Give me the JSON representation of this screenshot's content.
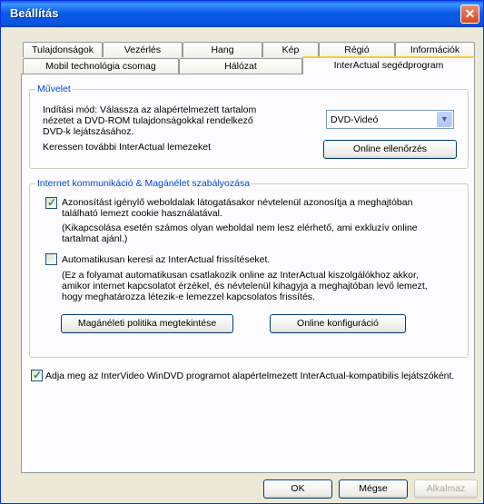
{
  "window": {
    "title": "Beállítás",
    "close_label": "✕"
  },
  "tabs_row1": [
    "Tulajdonságok",
    "Vezérlés",
    "Hang",
    "Kép",
    "Régió",
    "Információk"
  ],
  "tabs_row2": [
    "Mobil technológia csomag",
    "Hálózat",
    "InterActual segédprogram"
  ],
  "active_tab": "InterActual segédprogram",
  "muvelet": {
    "legend": "Művelet",
    "startup_line1": "Indítási mód: Válassza az alapértelmezett tartalom",
    "startup_line2": "nézetet a DVD-ROM tulajdonságokkal rendelkező",
    "startup_line3": "DVD-k lejátszásához.",
    "startup_select_value": "DVD-Videó",
    "search_label": "Keressen további InterActual lemezeket",
    "online_check_button": "Online ellenőrzés"
  },
  "privacy": {
    "legend": "Internet kommunikáció & Magánélet szabályozása",
    "cookie_line1": "Azonosítást igénylő weboldalak látogatásakor névtelenül azonosítja a meghajtóban",
    "cookie_line2": "található lemezt cookie használatával.",
    "cookie_note1": "(Kikapcsolása esetén számos olyan weboldal nem lesz elérhető, ami exkluzív online",
    "cookie_note2": "tartalmat ajánl.)",
    "cookie_checked": true,
    "auto_label": "Automatikusan keresi az InterActual frissítéseket.",
    "auto_checked": false,
    "auto_note1": "(Ez a folyamat automatikusan csatlakozik online az InterActual kiszolgálókhoz akkor,",
    "auto_note2": "amikor internet kapcsolatot érzékel, és névtelenül kihagyja a meghajtóban levő lemezt,",
    "auto_note3": "hogy meghatározza létezik-e lemezzel kapcsolatos frissítés.",
    "privacy_policy_button": "Magánéleti politika megtekintése",
    "online_config_button": "Online konfiguráció"
  },
  "default_player": {
    "label": "Adja meg az InterVideo WinDVD programot alapértelmezett InterActual-kompatibilis lejátszóként.",
    "checked": true
  },
  "footer": {
    "ok": "OK",
    "cancel": "Mégse",
    "apply": "Alkalmaz"
  },
  "colors": {
    "title_bar": "#0A5FE0",
    "group_legend": "#0046D5",
    "check_green": "#21A121",
    "face": "#ECE9D8"
  }
}
